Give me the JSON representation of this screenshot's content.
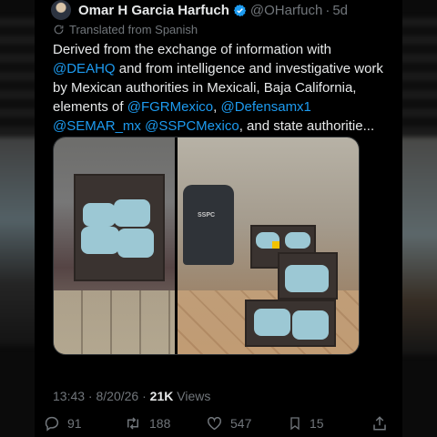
{
  "tweet": {
    "display_name": "Omar H Garcia Harfuch",
    "handle": "@OHarfuch",
    "separator": "·",
    "age": "5d",
    "translated_note": "Translated from Spanish",
    "text": {
      "p1": "Derived from the exchange of information with",
      "m1": "@DEAHQ",
      "p2": " and from intelligence and investigative work by Mexican authorities in Mexicali, Baja California, elements of ",
      "m2": "@FGRMexico",
      "p3": ", ",
      "m3": "@Defensamx1",
      "p4": " ",
      "m4": "@SEMAR_mx",
      "p5": " ",
      "m5": "@SSPCMexico",
      "p6": ", and state authoritie..."
    },
    "media": {
      "vest_label": "SSPC",
      "marker_label": "3"
    },
    "meta": {
      "time": "13:43",
      "sep": " · ",
      "date": "8/20/26",
      "sep2": " · ",
      "views_count": "21K",
      "views_label": "Views"
    },
    "actions": {
      "replies": "91",
      "reposts": "188",
      "likes": "547",
      "bookmarks": "15"
    },
    "colors": {
      "accent": "#1d9bf0",
      "text": "#e7e9ea",
      "muted": "#71767b",
      "background": "#000000"
    }
  }
}
